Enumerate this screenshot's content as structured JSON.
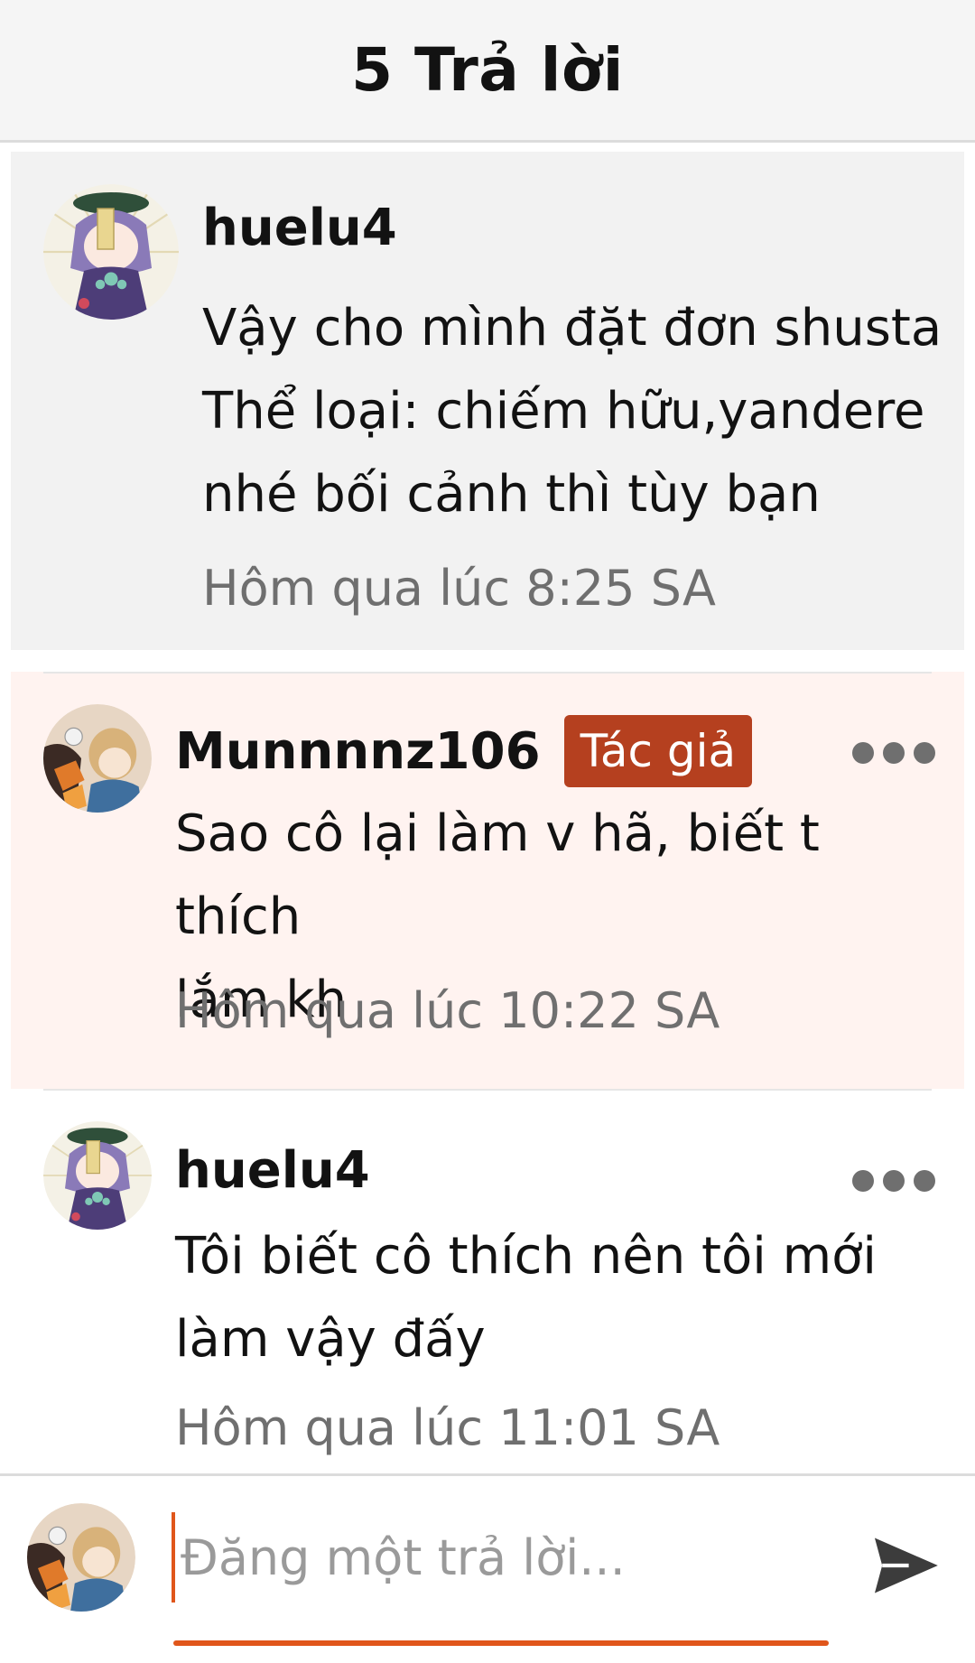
{
  "header": {
    "title": "5 Trả lời"
  },
  "comments": [
    {
      "username": "huelu4",
      "text": "Vậy cho mình đặt đơn shusta\nThể loại: chiếm hữu,yandere\nnhé bối cảnh thì tùy bạn",
      "timestamp": "Hôm qua lúc 8:25 SA",
      "avatar_icon": "avatar-purple-hair-character",
      "is_author": false
    },
    {
      "username": "Munnnnz106",
      "badge": "Tác giả",
      "text": "Sao cô lại làm v hã, biết t thích\nlắm kh",
      "timestamp": "Hôm qua lúc 10:22 SA",
      "avatar_icon": "avatar-orange-character",
      "is_author": true
    },
    {
      "username": "huelu4",
      "text": "Tôi biết cô thích nên tôi mới\nlàm vậy đấy",
      "timestamp": "Hôm qua lúc 11:01 SA",
      "avatar_icon": "avatar-purple-hair-character",
      "is_author": false
    }
  ],
  "composer": {
    "placeholder": "Đăng một trả lời...",
    "value": "",
    "send_icon": "send-icon"
  },
  "colors": {
    "accent": "#e0561b",
    "author_badge": "#b5401f",
    "author_highlight_bg": "#fff3f0",
    "selected_comment_bg": "#f2f2f2",
    "muted_text": "#6f6f6f"
  }
}
